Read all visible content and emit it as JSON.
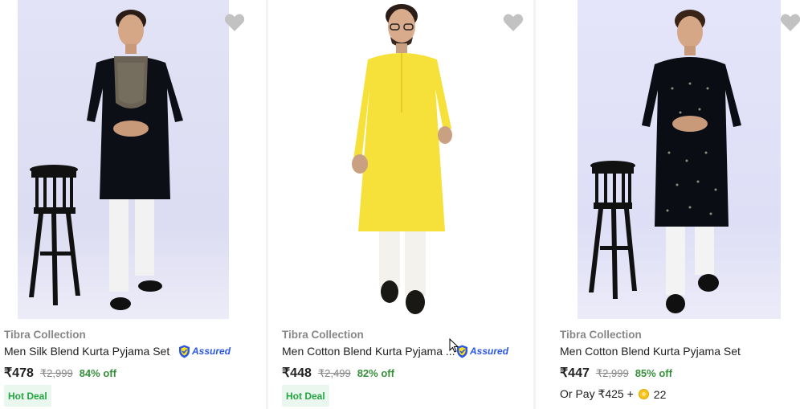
{
  "products": [
    {
      "brand": "Tibra Collection",
      "title": "Men Silk Blend Kurta Pyjama Set",
      "assured_label": "Assured",
      "price": "₹478",
      "mrp": "₹2,999",
      "discount": "84% off",
      "badge": "Hot Deal",
      "kurta_color": "#0d0f16"
    },
    {
      "brand": "Tibra Collection",
      "title": "Men Cotton Blend Kurta Pyjama ...",
      "assured_label": "Assured",
      "price": "₹448",
      "mrp": "₹2,499",
      "discount": "82% off",
      "badge": "Hot Deal",
      "kurta_color": "#f7e33d"
    },
    {
      "brand": "Tibra Collection",
      "title": "Men Cotton Blend Kurta Pyjama Set",
      "price": "₹447",
      "mrp": "₹2,999",
      "discount": "85% off",
      "or_pay_text": "Or Pay ₹425 +",
      "coins": "22",
      "kurta_color": "#0b0d14"
    }
  ],
  "colors": {
    "discount_green": "#388e3c",
    "assured_blue": "#2a55e5",
    "hot_deal_bg": "#e9f7ee",
    "wishlist_heart": "#c2c2c2"
  },
  "icons": [
    "heart-icon",
    "assured-shield-icon",
    "supercoin-icon",
    "mouse-cursor-icon"
  ]
}
